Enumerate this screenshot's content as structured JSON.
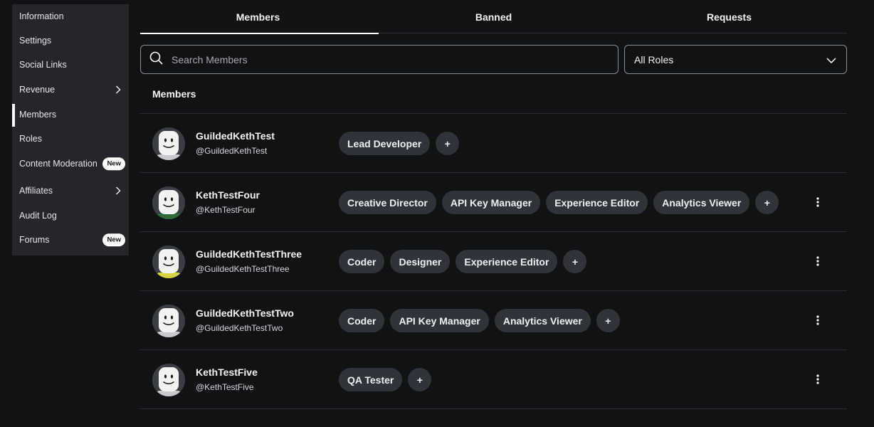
{
  "sidebar": {
    "items": [
      {
        "label": "Information"
      },
      {
        "label": "Settings"
      },
      {
        "label": "Social Links"
      },
      {
        "label": "Revenue",
        "icon": "chevron-right-icon"
      },
      {
        "label": "Members",
        "active": true
      },
      {
        "label": "Roles"
      },
      {
        "label": "Content Moderation",
        "badge": "New"
      },
      {
        "label": "Affiliates",
        "icon": "chevron-right-icon"
      },
      {
        "label": "Audit Log"
      },
      {
        "label": "Forums",
        "badge": "New"
      }
    ]
  },
  "tabs": [
    {
      "label": "Members",
      "active": true
    },
    {
      "label": "Banned"
    },
    {
      "label": "Requests"
    }
  ],
  "search": {
    "placeholder": "Search Members",
    "value": "",
    "icon": "search-icon"
  },
  "roles_filter": {
    "selected": "All Roles",
    "icon": "chevron-down-icon"
  },
  "members_section": {
    "title": "Members"
  },
  "members": [
    {
      "name": "GuildedKethTest",
      "handle": "@GuildedKethTest",
      "roles": [
        "Lead Developer"
      ],
      "add_label": "+",
      "has_menu": false
    },
    {
      "name": "KethTestFour",
      "handle": "@KethTestFour",
      "roles": [
        "Creative Director",
        "API Key Manager",
        "Experience Editor",
        "Analytics Viewer"
      ],
      "add_label": "+",
      "has_menu": true
    },
    {
      "name": "GuildedKethTestThree",
      "handle": "@GuildedKethTestThree",
      "roles": [
        "Coder",
        "Designer",
        "Experience Editor"
      ],
      "add_label": "+",
      "has_menu": true
    },
    {
      "name": "GuildedKethTestTwo",
      "handle": "@GuildedKethTestTwo",
      "roles": [
        "Coder",
        "API Key Manager",
        "Analytics Viewer"
      ],
      "add_label": "+",
      "has_menu": true
    },
    {
      "name": "KethTestFive",
      "handle": "@KethTestFive",
      "roles": [
        "QA Tester"
      ],
      "add_label": "+",
      "has_menu": true
    }
  ],
  "colors": {
    "background": "#111214",
    "sidebar": "#24262b",
    "pill": "#30333a",
    "border": "#2a2c31",
    "text": "#f3f3f4"
  }
}
